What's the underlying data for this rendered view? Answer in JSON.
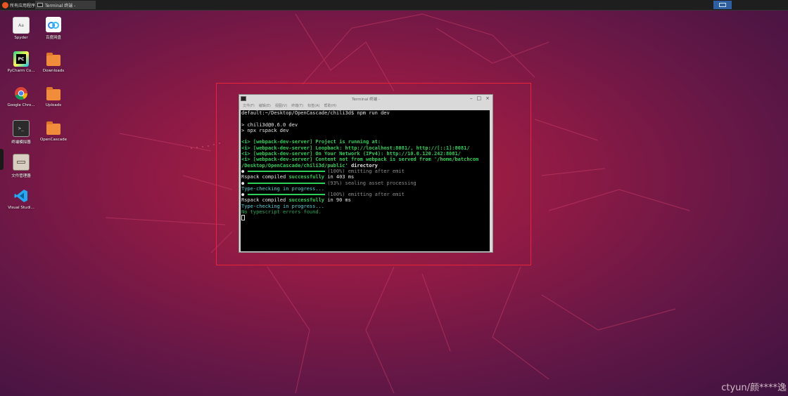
{
  "taskbar": {
    "start_label": "所有应用程序",
    "task_label": "Terminal 终端 -"
  },
  "desktop_icons": [
    {
      "label": "Spyder"
    },
    {
      "label": "百度网盘"
    },
    {
      "label": "PyCharm Co..."
    },
    {
      "label": "Downloads"
    },
    {
      "label": "Google Chro..."
    },
    {
      "label": "Uploads"
    },
    {
      "label": "终端模拟器"
    },
    {
      "label": "OpenCascade"
    },
    {
      "label": "文件管理器"
    },
    {
      "label": "Visual Studi..."
    }
  ],
  "terminal": {
    "title": "Terminal 终端 -",
    "menu": [
      "文件(F)",
      "编辑(E)",
      "视图(V)",
      "终端(T)",
      "标签(A)",
      "帮助(H)"
    ],
    "prompt": "default:~/Desktop/OpenCascade/chili3d$ npm run dev",
    "pkg_line": "> chili3d@0.6.0 dev",
    "cmd_line": "> npx rspack dev",
    "info1_tag": "<i>",
    "info1_src": "[webpack-dev-server]",
    "info1_msg": "Project is running at:",
    "info2_tag": "<i>",
    "info2_src": "[webpack-dev-server]",
    "info2_msg": "Loopback: http://localhost:8081/, http://[::1]:8081/",
    "info3_tag": "<i>",
    "info3_src": "[webpack-dev-server]",
    "info3_msg": "On Your Network (IPv4): http://10.0.120.242:8081/",
    "info4_tag": "<i>",
    "info4_src": "[webpack-dev-server]",
    "info4_msg": "Content not from webpack is served from '/home/batchcom",
    "info4_cont": "/Desktop/OpenCascade/chili3d/public'",
    "info4_dir": "directory",
    "progress1_text": "(100%) emitting after emit",
    "compiled1_a": "Rspack compiled",
    "compiled1_b": "successfully",
    "compiled1_c": "in 403 ms",
    "progress2_text": "(93%) sealing asset processing",
    "typecheck1": "Type-checking in progress...",
    "progress3_text": "(100%) emitting after emit",
    "compiled2_a": "Rspack compiled",
    "compiled2_b": "successfully",
    "compiled2_c": "in 90 ms",
    "typecheck2": "Type-checking in progress...",
    "no_errors": "No typescript errors found.",
    "bullet": "●"
  },
  "watermark": "ctyun/颜****逸"
}
